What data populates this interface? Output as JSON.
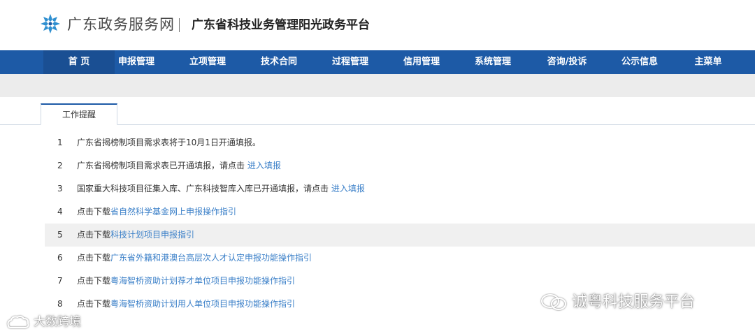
{
  "header": {
    "site_name": "广东政务服务网",
    "platform_name": "广东省科技业务管理阳光政务平台",
    "logo_icon": "snowflake-logo-icon"
  },
  "nav": {
    "items": [
      {
        "label": "首 页",
        "active": true
      },
      {
        "label": "申报管理"
      },
      {
        "label": "立项管理"
      },
      {
        "label": "技术合同"
      },
      {
        "label": "过程管理"
      },
      {
        "label": "信用管理"
      },
      {
        "label": "系统管理"
      },
      {
        "label": "咨询/投诉"
      },
      {
        "label": "公示信息"
      },
      {
        "label": "主菜单"
      }
    ]
  },
  "tabs": {
    "work_reminder": "工作提醒"
  },
  "list": {
    "rows": [
      {
        "num": "1",
        "text": "广东省揭榜制项目需求表将于10月1日开通填报。",
        "link": ""
      },
      {
        "num": "2",
        "text": "广东省揭榜制项目需求表已开通填报，请点击 ",
        "link": "进入填报"
      },
      {
        "num": "3",
        "text": "国家重大科技项目征集入库、广东科技智库入库已开通填报，请点击 ",
        "link": "进入填报"
      },
      {
        "num": "4",
        "text": "点击下载",
        "link": "省自然科学基金网上申报操作指引"
      },
      {
        "num": "5",
        "text": "点击下载",
        "link": "科技计划项目申报指引"
      },
      {
        "num": "6",
        "text": "点击下载",
        "link": "广东省外籍和港澳台高层次人才认定申报功能操作指引"
      },
      {
        "num": "7",
        "text": "点击下载",
        "link": "粤海智桥资助计划荐才单位项目申报功能操作指引"
      },
      {
        "num": "8",
        "text": "点击下载",
        "link": "粤海智桥资助计划用人单位项目申报功能操作指引"
      }
    ]
  },
  "watermarks": {
    "right": "诚粤科技服务平台",
    "left": "大数跨境"
  },
  "colors": {
    "nav_bg": "#1d5aa6",
    "link": "#3a7fc8",
    "band": "#ececec"
  }
}
